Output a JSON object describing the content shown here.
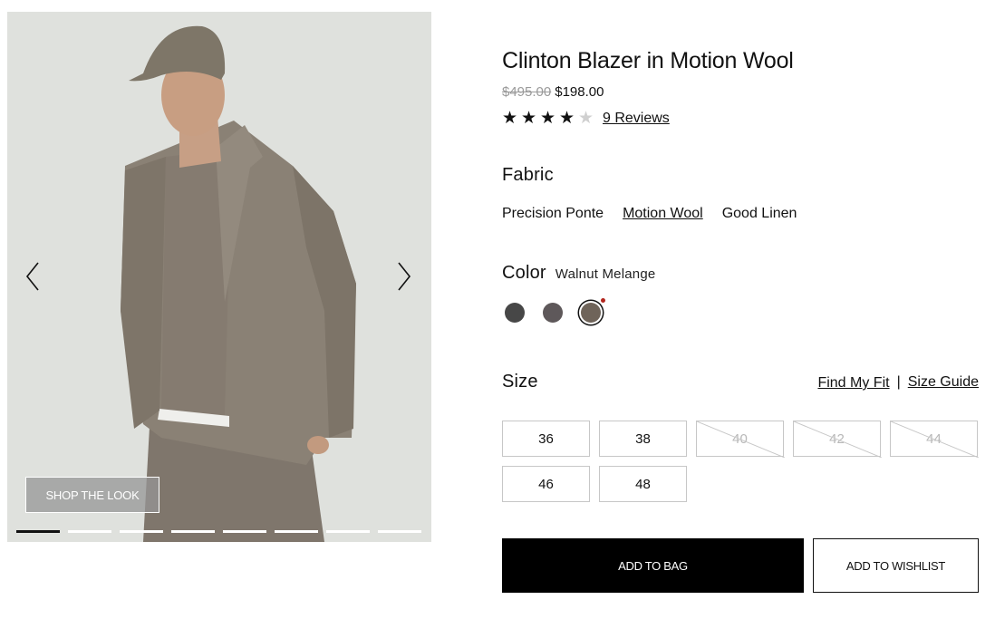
{
  "gallery": {
    "shop_the_look": "SHOP THE LOOK",
    "image_count": 8,
    "active_index": 0,
    "prev_icon": "chevron-left-icon",
    "next_icon": "chevron-right-icon"
  },
  "product": {
    "title": "Clinton Blazer in Motion Wool",
    "price_original": "$495.00",
    "price_sale": "$198.00",
    "rating": 4,
    "rating_max": 5,
    "reviews_label": "9 Reviews"
  },
  "fabric": {
    "label": "Fabric",
    "options": [
      {
        "label": "Precision Ponte",
        "selected": false
      },
      {
        "label": "Motion Wool",
        "selected": true
      },
      {
        "label": "Good Linen",
        "selected": false
      }
    ]
  },
  "color": {
    "label": "Color",
    "selected_name": "Walnut Melange",
    "swatches": [
      {
        "hex": "#474747",
        "selected": false
      },
      {
        "hex": "#5e585a",
        "selected": false
      },
      {
        "hex": "#6f645a",
        "selected": true
      }
    ]
  },
  "size": {
    "label": "Size",
    "find_fit": "Find My Fit",
    "separator": "|",
    "size_guide": "Size Guide",
    "options": [
      {
        "label": "36",
        "available": true
      },
      {
        "label": "38",
        "available": true
      },
      {
        "label": "40",
        "available": false
      },
      {
        "label": "42",
        "available": false
      },
      {
        "label": "44",
        "available": false
      },
      {
        "label": "46",
        "available": true
      },
      {
        "label": "48",
        "available": true
      }
    ]
  },
  "actions": {
    "add_to_bag": "ADD TO BAG",
    "add_to_wishlist": "ADD TO WISHLIST"
  },
  "colors": {
    "primary_button": "#000000",
    "selected_indicator": "#b3261e"
  }
}
